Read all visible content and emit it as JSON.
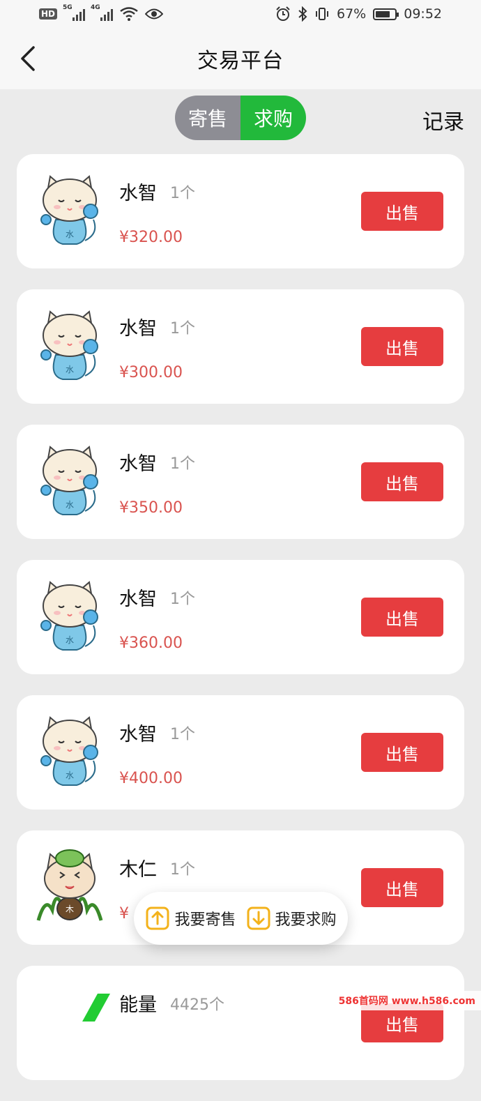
{
  "status": {
    "hd": "HD",
    "sig1": "5G",
    "sig2": "4G",
    "battery_pct": "67%",
    "time": "09:52"
  },
  "header": {
    "title": "交易平台"
  },
  "toggle": {
    "sell": "寄售",
    "buy": "求购",
    "active": "buy"
  },
  "records": "记录",
  "items": [
    {
      "name": "水智",
      "qty": "1个",
      "price": "¥320.00",
      "action": "出售",
      "avatar": "water-cat-avatar"
    },
    {
      "name": "水智",
      "qty": "1个",
      "price": "¥300.00",
      "action": "出售",
      "avatar": "water-cat-avatar"
    },
    {
      "name": "水智",
      "qty": "1个",
      "price": "¥350.00",
      "action": "出售",
      "avatar": "water-cat-avatar"
    },
    {
      "name": "水智",
      "qty": "1个",
      "price": "¥360.00",
      "action": "出售",
      "avatar": "water-cat-avatar"
    },
    {
      "name": "水智",
      "qty": "1个",
      "price": "¥400.00",
      "action": "出售",
      "avatar": "water-cat-avatar"
    },
    {
      "name": "木仁",
      "qty": "1个",
      "price": "¥",
      "action": "出售",
      "avatar": "wood-cat-avatar"
    },
    {
      "name": "能量",
      "qty": "4425个",
      "price": "",
      "action": "出售",
      "avatar": "energy-avatar"
    }
  ],
  "fab": {
    "consign": "我要寄售",
    "request": "我要求购"
  },
  "watermark": "586首码网 www.h586.com",
  "colors": {
    "green": "#22b93b",
    "red": "#e63d3f",
    "gray_toggle": "#8d8d94"
  }
}
